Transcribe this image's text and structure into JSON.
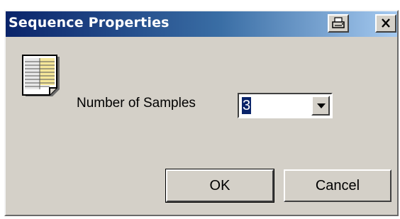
{
  "window": {
    "title": "Sequence Properties"
  },
  "titlebar_buttons": {
    "print_icon": "printer-icon",
    "close_icon": "close-icon"
  },
  "form": {
    "samples_label": "Number of Samples",
    "samples_value": "3"
  },
  "buttons": {
    "ok_label": "OK",
    "cancel_label": "Cancel"
  },
  "colors": {
    "title_gradient_start": "#0a246a",
    "title_gradient_end": "#a6caf0",
    "dialog_face": "#d4d0c8",
    "selection": "#0a246a"
  }
}
